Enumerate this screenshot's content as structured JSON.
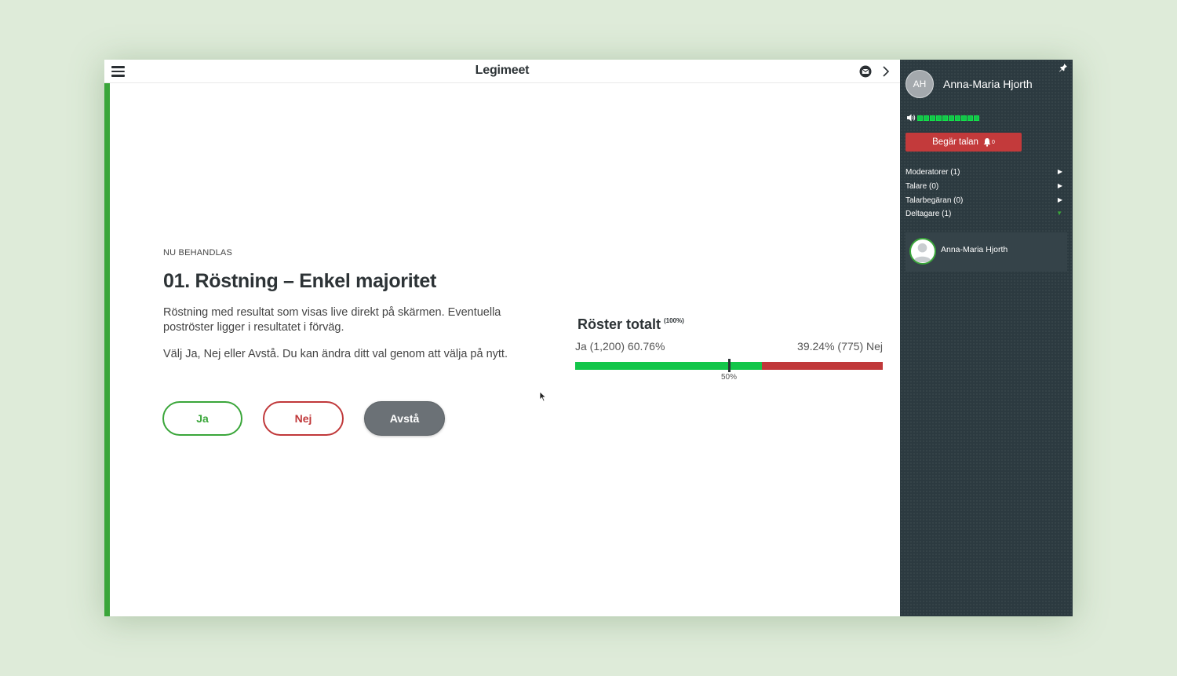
{
  "app": {
    "brand": "Legimeet"
  },
  "agenda": {
    "status_label": "NU BEHANDLAS",
    "title": "01. Röstning – Enkel majoritet",
    "description_1": "Röstning med resultat som visas live direkt på skärmen. Eventuella poströster ligger i resultatet i förväg.",
    "description_2": "Välj Ja, Nej eller Avstå. Du kan ändra ditt val genom att välja på nytt."
  },
  "vote_buttons": {
    "yes": "Ja",
    "no": "Nej",
    "abstain": "Avstå"
  },
  "results": {
    "title": "Röster totalt",
    "total_percent": "(100%)",
    "yes_label": "Ja (1,200) 60.76%",
    "no_label": "39.24% (775) Nej",
    "midpoint_label": "50%",
    "yes_share": 0.6076,
    "yes_color": "#13c64a",
    "no_color": "#c0383a"
  },
  "sidebar": {
    "user_initials": "AH",
    "user_name": "Anna-Maria Hjorth",
    "audio_level_segments": 10,
    "request_speech_label": "Begär talan",
    "request_count": "0",
    "sections": [
      {
        "label": "Moderatorer (1)",
        "expanded": false
      },
      {
        "label": "Talare (0)",
        "expanded": false
      },
      {
        "label": "Talarbegäran (0)",
        "expanded": false
      },
      {
        "label": "Deltagare (1)",
        "expanded": true
      }
    ],
    "participants": [
      {
        "name": "Anna-Maria Hjorth"
      }
    ]
  }
}
